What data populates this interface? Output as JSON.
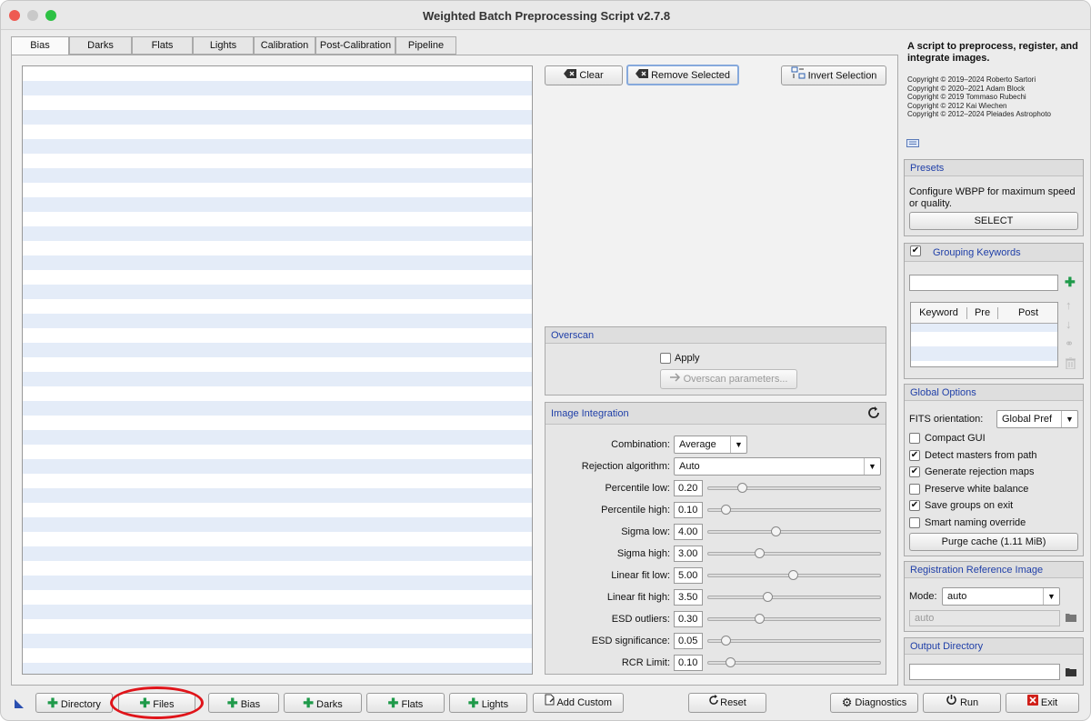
{
  "window": {
    "title": "Weighted Batch Preprocessing Script v2.7.8"
  },
  "tabs": [
    "Bias",
    "Darks",
    "Flats",
    "Lights",
    "Calibration",
    "Post-Calibration",
    "Pipeline"
  ],
  "toolbar": {
    "clear": "Clear",
    "remove_selected": "Remove Selected",
    "invert_selection": "Invert Selection"
  },
  "overscan": {
    "title": "Overscan",
    "apply": "Apply",
    "parameters": "Overscan parameters..."
  },
  "integration": {
    "title": "Image Integration",
    "combination_label": "Combination:",
    "combination_value": "Average",
    "rejection_label": "Rejection algorithm:",
    "rejection_value": "Auto",
    "params": [
      {
        "label": "Percentile low:",
        "value": "0.20",
        "level": 0.2
      },
      {
        "label": "Percentile high:",
        "value": "0.10",
        "level": 0.1
      },
      {
        "label": "Sigma low:",
        "value": "4.00",
        "level": 0.4
      },
      {
        "label": "Sigma high:",
        "value": "3.00",
        "level": 0.3
      },
      {
        "label": "Linear fit low:",
        "value": "5.00",
        "level": 0.5
      },
      {
        "label": "Linear fit high:",
        "value": "3.50",
        "level": 0.35
      },
      {
        "label": "ESD outliers:",
        "value": "0.30",
        "level": 0.3
      },
      {
        "label": "ESD significance:",
        "value": "0.05",
        "level": 0.1
      },
      {
        "label": "RCR Limit:",
        "value": "0.10",
        "level": 0.13
      }
    ]
  },
  "about": {
    "heading": "A script to preprocess, register, and integrate images.",
    "copyrights": [
      "Copyright © 2019–2024 Roberto Sartori",
      "Copyright © 2020–2021 Adam Block",
      "Copyright © 2019 Tommaso Rubechi",
      "Copyright © 2012 Kai Wiechen",
      "Copyright © 2012–2024 Pleiades Astrophoto"
    ]
  },
  "presets": {
    "title": "Presets",
    "text": "Configure WBPP for maximum speed or quality.",
    "select": "SELECT"
  },
  "grouping": {
    "title": "Grouping Keywords",
    "columns": [
      "Keyword",
      "Pre",
      "Post"
    ]
  },
  "global": {
    "title": "Global Options",
    "fits_label": "FITS orientation:",
    "fits_value": "Global Pref",
    "options": [
      {
        "label": "Compact GUI",
        "checked": false
      },
      {
        "label": "Detect masters from path",
        "checked": true
      },
      {
        "label": "Generate rejection maps",
        "checked": true
      },
      {
        "label": "Preserve white balance",
        "checked": false
      },
      {
        "label": "Save groups on exit",
        "checked": true
      },
      {
        "label": "Smart naming override",
        "checked": false
      }
    ],
    "purge": "Purge cache (1.11 MiB)"
  },
  "registration": {
    "title": "Registration Reference Image",
    "mode_label": "Mode:",
    "mode_value": "auto",
    "placeholder": "auto"
  },
  "output": {
    "title": "Output Directory"
  },
  "bottom": {
    "directory": "Directory",
    "files": "Files",
    "bias": "Bias",
    "darks": "Darks",
    "flats": "Flats",
    "lights": "Lights",
    "add_custom": "Add Custom",
    "reset": "Reset",
    "diagnostics": "Diagnostics",
    "run": "Run",
    "exit": "Exit"
  },
  "colors": {
    "accent_blue": "#1f3fa8",
    "add_green": "#1f9a4a",
    "exit_red": "#d0201a",
    "highlight_circle": "#e0141a"
  }
}
